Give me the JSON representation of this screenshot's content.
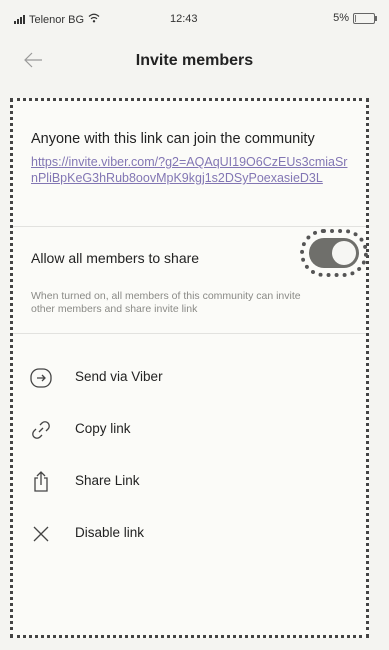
{
  "status_bar": {
    "carrier": "Telenor BG",
    "time": "12:43",
    "battery": "5%",
    "battery_level": 0.05
  },
  "nav": {
    "title": "Invite members",
    "back_icon": "back-arrow-icon"
  },
  "invite": {
    "description": "Anyone with this link can join the community",
    "link": "https://invite.viber.com/?g2=AQAqUI19O6CzEUs3cmiaSrnPliBpKeG3hRub8oovMpK9kgj1s2DSyPoexasieD3L"
  },
  "share_setting": {
    "label": "Allow all members to share",
    "enabled": true,
    "description": "When turned on, all members of this community can invite other members and share invite link"
  },
  "actions": [
    {
      "label": "Send via Viber",
      "icon": "send-via-viber-icon"
    },
    {
      "label": "Copy link",
      "icon": "link-icon"
    },
    {
      "label": "Share Link",
      "icon": "share-icon"
    },
    {
      "label": "Disable link",
      "icon": "close-icon"
    }
  ],
  "colors": {
    "link": "#6d5fa8",
    "toggle_on": "#6f6f6b",
    "background": "#f4f4f1"
  }
}
